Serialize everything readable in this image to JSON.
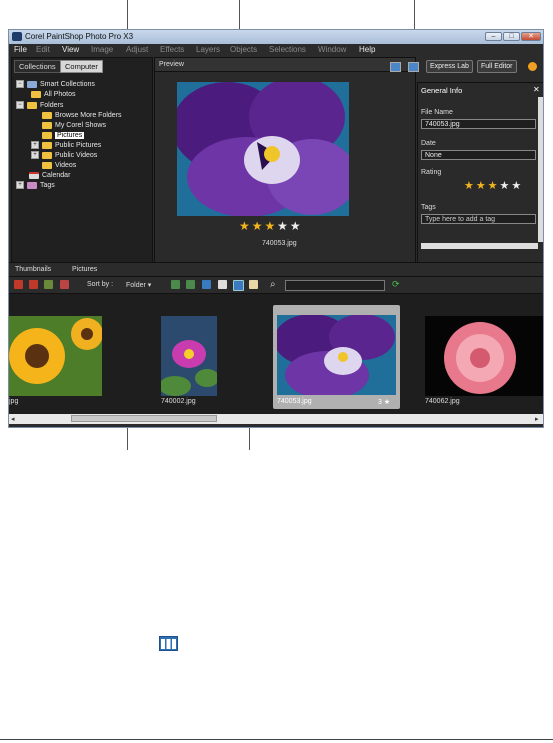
{
  "window": {
    "title": "Corel PaintShop Photo Pro X3"
  },
  "menu": [
    "File",
    "Edit",
    "View",
    "Image",
    "Adjust",
    "Effects",
    "Layers",
    "Objects",
    "Selections",
    "Window",
    "Help"
  ],
  "left": {
    "tabs": [
      "Collections",
      "Computer"
    ],
    "tree": [
      "Smart Collections",
      "All Photos",
      "Folders",
      "Browse More Folders",
      "My Corel Shows",
      "Pictures",
      "Public Pictures",
      "Public Videos",
      "Videos",
      "Calendar",
      "Tags"
    ]
  },
  "preview": {
    "label": "Preview",
    "express_lab": "Express Lab",
    "full_editor": "Full Editor",
    "filename": "740053.jpg",
    "rating": 3
  },
  "info": {
    "title": "General Info",
    "close": "✕",
    "file_name_label": "File Name",
    "file_name": "740053.jpg",
    "date_label": "Date",
    "date": "None",
    "rating_label": "Rating",
    "rating": 3,
    "tags_label": "Tags",
    "tags_placeholder": "Type here to add a tag"
  },
  "thumbs": {
    "tabs": [
      "Thumbnails",
      "Pictures"
    ],
    "sort_label": "Sort by :",
    "sort_value": "Folder",
    "items": [
      {
        "name": "jpg"
      },
      {
        "name": "740002.jpg"
      },
      {
        "name": "740053.jpg",
        "rating": "3 ★"
      },
      {
        "name": "740062.jpg"
      }
    ]
  },
  "colors": {
    "accent": "#2f6fb3",
    "star": "#f2b51f"
  }
}
